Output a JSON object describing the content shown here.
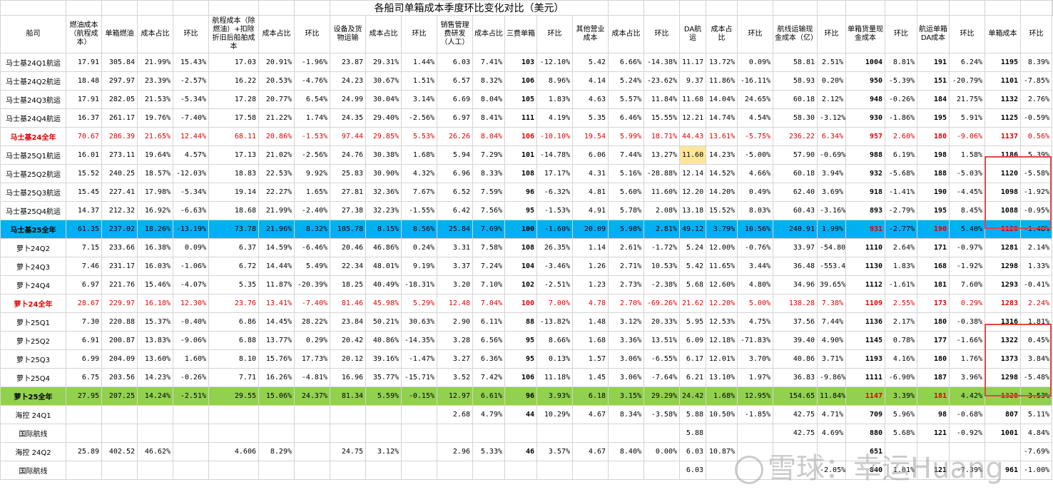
{
  "title": "各船司单箱成本季度环比变化对比（美元）",
  "headers": [
    "船司",
    "燃油成本（航程成本）",
    "单箱燃油",
    "成本占比",
    "环比",
    "航程成本（除燃油）+扣除折旧后船舶成本",
    "成本占比",
    "环比",
    "设备及货物运输",
    "成本占比",
    "环比",
    "销售管理费研发（人工）",
    "成本占比",
    "三费单箱",
    "环比",
    "其他营业成本",
    "成本占比",
    "环比",
    "DA航运",
    "成本占比",
    "环比",
    "航线运输现金成本（亿）",
    "环比",
    "单箱货量现金成本",
    "环比",
    "航运单箱DA成本",
    "环比",
    "单箱成本",
    "环比"
  ],
  "rows": [
    {
      "style": "normal",
      "cells": [
        "马士基24Q1航运",
        "17.91",
        "305.84",
        "21.99%",
        "15.43%",
        "17.03",
        "20.91%",
        "-1.96%",
        "23.87",
        "29.31%",
        "1.44%",
        "6.03",
        "7.41%",
        "103",
        "-12.10%",
        "5.42",
        "6.66%",
        "-14.38%",
        "11.17",
        "13.72%",
        "0.09%",
        "58.81",
        "2.51%",
        "1004",
        "8.81%",
        "191",
        "6.24%",
        "1195",
        "8.39%"
      ]
    },
    {
      "style": "normal",
      "cells": [
        "马士基24Q2航运",
        "18.48",
        "297.97",
        "23.39%",
        "-2.57%",
        "16.22",
        "20.53%",
        "-4.76%",
        "24.23",
        "30.67%",
        "1.51%",
        "6.57",
        "8.32%",
        "106",
        "8.96%",
        "4.14",
        "5.24%",
        "-23.62%",
        "9.37",
        "11.86%",
        "-16.11%",
        "58.93",
        "0.20%",
        "950",
        "-5.39%",
        "151",
        "-20.79%",
        "1101",
        "-7.85%"
      ]
    },
    {
      "style": "normal",
      "cells": [
        "马士基24Q3航运",
        "17.91",
        "282.05",
        "21.53%",
        "-5.34%",
        "17.28",
        "20.77%",
        "6.54%",
        "24.99",
        "30.04%",
        "3.14%",
        "6.69",
        "8.04%",
        "105",
        "1.83%",
        "4.63",
        "5.57%",
        "11.84%",
        "11.68",
        "14.04%",
        "24.65%",
        "60.18",
        "2.12%",
        "948",
        "-0.26%",
        "184",
        "21.75%",
        "1132",
        "2.76%"
      ]
    },
    {
      "style": "normal",
      "cells": [
        "马士基24Q4航运",
        "16.37",
        "261.17",
        "19.76%",
        "-7.40%",
        "17.58",
        "21.22%",
        "1.74%",
        "24.35",
        "29.40%",
        "-2.56%",
        "6.97",
        "8.41%",
        "111",
        "4.19%",
        "5.35",
        "6.46%",
        "15.55%",
        "12.21",
        "14.74%",
        "4.54%",
        "58.30",
        "-3.12%",
        "930",
        "-1.86%",
        "195",
        "5.91%",
        "1125",
        "-0.59%"
      ]
    },
    {
      "style": "red",
      "cells": [
        "马士基24全年",
        "70.67",
        "286.39",
        "21.65%",
        "12.44%",
        "68.11",
        "20.86%",
        "-1.53%",
        "97.44",
        "29.85%",
        "5.53%",
        "26.26",
        "8.04%",
        "106",
        "-10.10%",
        "19.54",
        "5.99%",
        "18.71%",
        "44.43",
        "13.61%",
        "-5.75%",
        "236.22",
        "6.34%",
        "957",
        "2.60%",
        "180",
        "-9.06%",
        "1137",
        "0.56%"
      ]
    },
    {
      "style": "normal",
      "cells": [
        "马士基25Q1航运",
        "16.01",
        "273.11",
        "19.64%",
        "4.57%",
        "17.13",
        "21.02%",
        "-2.56%",
        "24.76",
        "30.38%",
        "1.68%",
        "5.94",
        "7.29%",
        "101",
        "-14.78%",
        "6.06",
        "7.44%",
        "13.27%",
        "11.60",
        "14.23%",
        "-5.00%",
        "57.90",
        "-0.69%",
        "988",
        "6.19%",
        "198",
        "1.58%",
        "1186",
        "5.39%"
      ]
    },
    {
      "style": "normal",
      "cells": [
        "马士基25Q2航运",
        "15.52",
        "240.25",
        "18.57%",
        "-12.03%",
        "18.83",
        "22.53%",
        "9.92%",
        "25.83",
        "30.90%",
        "4.32%",
        "6.96",
        "8.33%",
        "108",
        "17.17%",
        "4.31",
        "5.16%",
        "-28.88%",
        "12.14",
        "14.52%",
        "4.66%",
        "60.18",
        "3.94%",
        "932",
        "-5.68%",
        "188",
        "-5.03%",
        "1120",
        "-5.58%"
      ]
    },
    {
      "style": "normal",
      "cells": [
        "马士基25Q3航运",
        "15.45",
        "227.41",
        "17.98%",
        "-5.34%",
        "19.14",
        "22.27%",
        "1.65%",
        "27.81",
        "32.36%",
        "7.67%",
        "6.52",
        "7.59%",
        "96",
        "-6.32%",
        "4.81",
        "5.60%",
        "11.60%",
        "12.20",
        "14.20%",
        "0.49%",
        "62.40",
        "3.69%",
        "918",
        "-1.41%",
        "190",
        "-4.45%",
        "1098",
        "-1.92%"
      ]
    },
    {
      "style": "normal",
      "cells": [
        "马士基25Q4航运",
        "14.37",
        "212.32",
        "16.92%",
        "-6.63%",
        "18.68",
        "21.99%",
        "-2.40%",
        "27.38",
        "32.23%",
        "-1.55%",
        "6.42",
        "7.56%",
        "95",
        "-1.53%",
        "4.91",
        "5.78%",
        "2.08%",
        "13.18",
        "15.52%",
        "8.03%",
        "60.43",
        "-3.16%",
        "893",
        "-2.79%",
        "195",
        "8.45%",
        "1088",
        "-0.95%"
      ]
    },
    {
      "style": "blue",
      "cells": [
        "马士基25全年",
        "61.35",
        "237.02",
        "18.26%",
        "-13.19%",
        "73.78",
        "21.96%",
        "8.32%",
        "105.78",
        "8.15%",
        "8.56%",
        "25.84",
        "7.69%",
        "100",
        "-1.60%",
        "20.09",
        "5.98%",
        "2.81%",
        "49.12",
        "3.79%",
        "10.56%",
        "240.91",
        "1.99%",
        "931",
        "-2.77%",
        "190",
        "5.40%",
        "1120",
        "-1.48%"
      ]
    },
    {
      "style": "normal",
      "cells": [
        "萝卜24Q2",
        "7.15",
        "233.66",
        "16.38%",
        "0.09%",
        "6.37",
        "14.59%",
        "-6.46%",
        "20.46",
        "46.86%",
        "0.24%",
        "3.31",
        "7.58%",
        "108",
        "26.35%",
        "1.14",
        "2.61%",
        "-1.72%",
        "5.24",
        "12.00%",
        "-0.76%",
        "33.97",
        "-54.80%",
        "1110",
        "2.64%",
        "171",
        "-0.97%",
        "1281",
        "2.14%"
      ]
    },
    {
      "style": "normal",
      "cells": [
        "萝卜24Q3",
        "7.46",
        "231.17",
        "16.03%",
        "-1.06%",
        "6.72",
        "14.44%",
        "5.49%",
        "22.34",
        "48.01%",
        "9.19%",
        "3.37",
        "7.24%",
        "104",
        "-3.46%",
        "1.26",
        "2.71%",
        "10.53%",
        "5.42",
        "11.65%",
        "3.44%",
        "36.48",
        "-553.44%",
        "1130",
        "1.83%",
        "168",
        "-1.92%",
        "1298",
        "1.33%"
      ]
    },
    {
      "style": "normal",
      "cells": [
        "萝卜24Q4",
        "6.97",
        "221.76",
        "15.46%",
        "-4.07%",
        "5.35",
        "11.87%",
        "-20.39%",
        "18.25",
        "40.49%",
        "-18.31%",
        "3.20",
        "7.10%",
        "102",
        "-2.51%",
        "1.23",
        "2.73%",
        "-2.38%",
        "5.68",
        "12.60%",
        "4.80%",
        "34.96",
        "39.65%",
        "1112",
        "-1.61%",
        "181",
        "7.60%",
        "1293",
        "-0.41%"
      ]
    },
    {
      "style": "red",
      "cells": [
        "萝卜24全年",
        "28.67",
        "229.97",
        "16.18%",
        "12.30%",
        "23.76",
        "13.41%",
        "-7.40%",
        "81.46",
        "45.98%",
        "5.29%",
        "12.48",
        "7.04%",
        "100",
        "7.00%",
        "4.78",
        "2.70%",
        "-69.26%",
        "21.62",
        "12.20%",
        "5.00%",
        "138.28",
        "7.38%",
        "1109",
        "2.55%",
        "173",
        "0.29%",
        "1283",
        "2.24%"
      ]
    },
    {
      "style": "normal",
      "cells": [
        "萝卜25Q1",
        "7.30",
        "220.88",
        "15.37%",
        "-0.40%",
        "6.86",
        "14.45%",
        "28.22%",
        "23.84",
        "50.21%",
        "30.63%",
        "2.90",
        "6.11%",
        "88",
        "-13.82%",
        "1.48",
        "3.12%",
        "20.33%",
        "5.95",
        "12.53%",
        "4.75%",
        "37.56",
        "7.44%",
        "1136",
        "2.17%",
        "180",
        "-0.38%",
        "1316",
        "1.81%"
      ]
    },
    {
      "style": "normal",
      "cells": [
        "萝卜25Q2",
        "6.91",
        "200.87",
        "13.83%",
        "-9.06%",
        "6.88",
        "13.77%",
        "0.29%",
        "20.42",
        "40.86%",
        "-14.35%",
        "3.28",
        "6.56%",
        "95",
        "8.66%",
        "1.68",
        "3.36%",
        "13.51%",
        "6.09",
        "12.18%",
        "-71.83%",
        "39.40",
        "4.90%",
        "1145",
        "0.78%",
        "177",
        "-1.66%",
        "1322",
        "0.45%"
      ]
    },
    {
      "style": "normal",
      "cells": [
        "萝卜25Q3",
        "6.99",
        "204.09",
        "13.60%",
        "1.60%",
        "8.10",
        "15.76%",
        "17.73%",
        "20.12",
        "39.16%",
        "-1.47%",
        "3.27",
        "6.36%",
        "95",
        "0.13%",
        "1.57",
        "3.06%",
        "-6.55%",
        "6.17",
        "12.01%",
        "3.70%",
        "40.86",
        "3.71%",
        "1193",
        "4.16%",
        "180",
        "1.76%",
        "1373",
        "3.84%"
      ]
    },
    {
      "style": "normal",
      "cells": [
        "萝卜25Q4",
        "6.75",
        "203.56",
        "14.23%",
        "-0.26%",
        "7.71",
        "16.26%",
        "-4.81%",
        "16.96",
        "35.77%",
        "-15.71%",
        "3.52",
        "7.42%",
        "106",
        "11.18%",
        "1.45",
        "3.06%",
        "-7.64%",
        "6.21",
        "13.10%",
        "1.97%",
        "36.83",
        "-9.86%",
        "1111",
        "-6.90%",
        "187",
        "3.96%",
        "1298",
        "-5.48%"
      ]
    },
    {
      "style": "green",
      "cells": [
        "萝卜25全年",
        "27.95",
        "207.25",
        "14.24%",
        "-2.51%",
        "29.55",
        "15.06%",
        "24.37%",
        "81.34",
        "5.59%",
        "-0.15%",
        "12.97",
        "6.61%",
        "96",
        "3.93%",
        "6.18",
        "3.15%",
        "29.29%",
        "24.42",
        "1.68%",
        "12.95%",
        "154.65",
        "11.84%",
        "1147",
        "3.39%",
        "181",
        "4.42%",
        "1328",
        "3.53%"
      ]
    },
    {
      "style": "normal",
      "cells": [
        "海控 24Q1",
        "",
        "",
        "",
        "",
        "",
        "",
        "",
        "",
        "",
        "",
        "2.68",
        "4.79%",
        "44",
        "10.29%",
        "4.67",
        "8.34%",
        "-3.58%",
        "5.88",
        "10.50%",
        "-1.85%",
        "42.75",
        "4.71%",
        "709",
        "5.96%",
        "98",
        "-0.68%",
        "807",
        "5.11%"
      ]
    },
    {
      "style": "normal",
      "cells": [
        "国际航线",
        "",
        "",
        "",
        "",
        "",
        "",
        "",
        "",
        "",
        "",
        "",
        "",
        "",
        "",
        "",
        "",
        "",
        "5.88",
        "",
        "",
        "42.75",
        "4.69%",
        "880",
        "5.68%",
        "121",
        "-0.92%",
        "1001",
        "4.84%"
      ]
    },
    {
      "style": "normal",
      "cells": [
        "海控 24Q2",
        "25.89",
        "402.52",
        "46.62%",
        "",
        "4.606",
        "8.29%",
        "",
        "24.75",
        "3.12%",
        "",
        "2.96",
        "5.33%",
        "46",
        "3.57%",
        "4.67",
        "8.40%",
        "0.00%",
        "6.03",
        "10.87%",
        "",
        "",
        "",
        "651",
        "",
        "",
        "",
        "",
        "-7.69%"
      ]
    },
    {
      "style": "normal",
      "cells": [
        "国际航线",
        "",
        "",
        "",
        "",
        "",
        "",
        "",
        "",
        "",
        "",
        "",
        "",
        "",
        "",
        "",
        "",
        "",
        "6.03",
        "",
        "",
        "",
        "-2.05%",
        "840",
        "1.01%",
        "121",
        "-7.39%",
        "961",
        "-1.00%"
      ]
    }
  ],
  "watermark": "雪球：幸运Huang"
}
